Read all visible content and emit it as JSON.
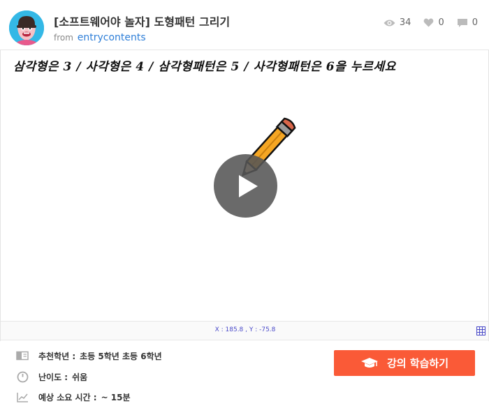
{
  "header": {
    "title": "[소프트웨어야 놀자] 도형패턴 그리기",
    "from_label": "from",
    "author": "entrycontents",
    "views": "34",
    "likes": "0",
    "comments": "0",
    "avatar_icon": "character-avatar-icon"
  },
  "stage": {
    "instruction_text": "삼각형은 3 / 사각형은 4 / 삼각형패턴은 5 / 사각형패턴은 6을 누르세요",
    "sprite": "pencil-sprite",
    "play_icon": "play-icon"
  },
  "coords": {
    "text": "X : 185.8 , Y : -75.8"
  },
  "info": {
    "grade_label": "추천학년 :",
    "grade_value": "초등 5학년 초등 6학년",
    "difficulty_label": "난이도 :",
    "difficulty_value": "쉬움",
    "time_label": "예상 소요 시간 :",
    "time_value": "~ 15분"
  },
  "learn_button": {
    "label": "강의 학습하기"
  },
  "colors": {
    "accent": "#fa5a37",
    "link": "#2f7fd8",
    "coords": "#4a4ac9",
    "avatar_bg": "#34b8e6"
  }
}
